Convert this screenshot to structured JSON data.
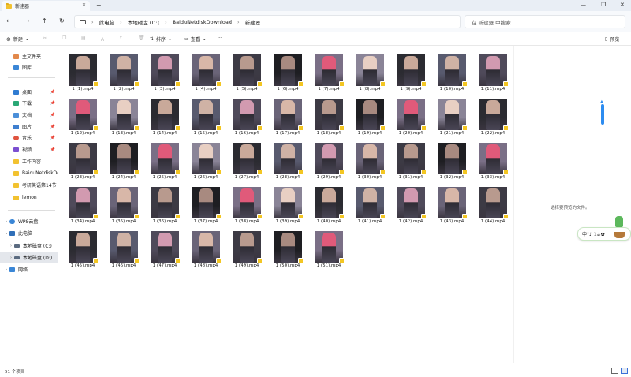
{
  "tab": {
    "title": "新建器",
    "close": "✕",
    "new": "+"
  },
  "window": {
    "minimize": "—",
    "maximize": "❐",
    "close": "✕"
  },
  "address": {
    "segments": [
      "此电脑",
      "本地磁盘 (D:)",
      "BaiduNetdiskDownload",
      "新建器"
    ],
    "sep": "›"
  },
  "search": {
    "placeholder": "在 新建器 中搜索"
  },
  "toolbar": {
    "new": "新建",
    "sort": "排序",
    "view": "查看",
    "more": "···",
    "preview": "预览"
  },
  "sidebar": {
    "quick": [
      "主文件夹",
      "图库"
    ],
    "pinned": [
      "桌面",
      "下载",
      "文档",
      "图片",
      "音乐",
      "视频",
      "工作内容",
      "BaiduNetdiskDow",
      "考研英语第14节",
      "lemon"
    ],
    "drives": [
      "WPS云盘",
      "此电脑",
      "本地磁盘 (C:)",
      "本地磁盘 (D:)",
      "网络"
    ]
  },
  "files": [
    "1 (1).mp4",
    "1 (2).mp4",
    "1 (3).mp4",
    "1 (4).mp4",
    "1 (5).mp4",
    "1 (6).mp4",
    "1 (7).mp4",
    "1 (8).mp4",
    "1 (9).mp4",
    "1 (10).mp4",
    "1 (11).mp4",
    "1 (12).mp4",
    "1 (13).mp4",
    "1 (14).mp4",
    "1 (15).mp4",
    "1 (16).mp4",
    "1 (17).mp4",
    "1 (18).mp4",
    "1 (19).mp4",
    "1 (20).mp4",
    "1 (21).mp4",
    "1 (22).mp4",
    "1 (23).mp4",
    "1 (24).mp4",
    "1 (25).mp4",
    "1 (26).mp4",
    "1 (27).mp4",
    "1 (28).mp4",
    "1 (29).mp4",
    "1 (30).mp4",
    "1 (31).mp4",
    "1 (32).mp4",
    "1 (33).mp4",
    "1 (34).mp4",
    "1 (35).mp4",
    "1 (36).mp4",
    "1 (37).mp4",
    "1 (38).mp4",
    "1 (39).mp4",
    "1 (40).mp4",
    "1 (41).mp4",
    "1 (42).mp4",
    "1 (43).mp4",
    "1 (44).mp4",
    "1 (45).mp4",
    "1 (46).mp4",
    "1 (47).mp4",
    "1 (48).mp4",
    "1 (49).mp4",
    "1 (50).mp4",
    "1 (51).mp4"
  ],
  "details": {
    "hint": "选择要预览的文件。"
  },
  "widget": {
    "text": "中°♪☽☕✿"
  },
  "status": {
    "count": "51 个项目"
  },
  "colors": {
    "accent": "#2d8cf0",
    "folder": "#f2c230",
    "badge": "#f3c623"
  }
}
